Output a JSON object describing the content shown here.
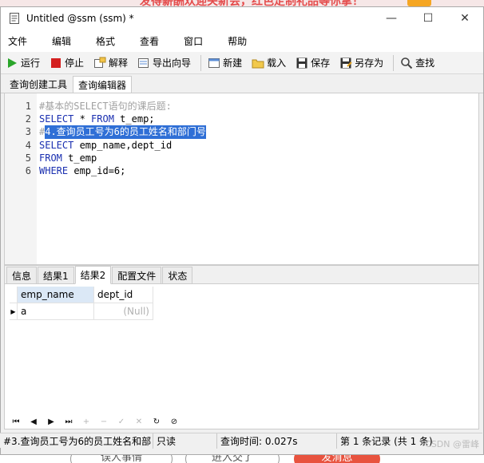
{
  "background": {
    "banner_text": "发得薪酬欢迎关新会，红色定制礼品等你拿！",
    "bottom_pills": [
      "误人事情",
      "进入交了",
      "发消息"
    ]
  },
  "window": {
    "title": "Untitled @ssm (ssm) *",
    "controls": {
      "minimize": "—",
      "maximize": "☐",
      "close": "✕"
    }
  },
  "menu": [
    "文件",
    "编辑",
    "格式",
    "查看",
    "窗口",
    "帮助"
  ],
  "toolbar": {
    "run": "运行",
    "stop": "停止",
    "explain": "解释",
    "export": "导出向导",
    "new": "新建",
    "load": "载入",
    "save": "保存",
    "save_as": "另存为",
    "find": "查找"
  },
  "tabs": [
    "查询创建工具",
    "查询编辑器"
  ],
  "editor": {
    "lines": [
      {
        "n": "1",
        "parts": [
          {
            "t": "#基本的SELECT语句的课后题:",
            "c": "cm"
          }
        ]
      },
      {
        "n": "2",
        "parts": [
          {
            "t": "SELECT",
            "c": "kw"
          },
          {
            "t": " * ",
            "c": ""
          },
          {
            "t": "FROM",
            "c": "kw"
          },
          {
            "t": " t_emp;",
            "c": ""
          }
        ]
      },
      {
        "n": "3",
        "parts": [
          {
            "t": "#",
            "c": "cm"
          },
          {
            "t": "4.查询员工号为6的员工姓名和部门号",
            "c": "sel"
          }
        ]
      },
      {
        "n": "4",
        "parts": [
          {
            "t": "SELECT",
            "c": "kw"
          },
          {
            "t": " emp_name,dept_id",
            "c": ""
          }
        ]
      },
      {
        "n": "5",
        "parts": [
          {
            "t": "FROM",
            "c": "kw"
          },
          {
            "t": " t_emp",
            "c": ""
          }
        ]
      },
      {
        "n": "6",
        "parts": [
          {
            "t": "WHERE",
            "c": "kw"
          },
          {
            "t": " emp_id=6;",
            "c": ""
          }
        ]
      }
    ]
  },
  "result_tabs": [
    "信息",
    "结果1",
    "结果2",
    "配置文件",
    "状态"
  ],
  "result_grid": {
    "columns": [
      "emp_name",
      "dept_id"
    ],
    "rows": [
      [
        "a",
        "(Null)"
      ]
    ]
  },
  "status": {
    "query": "#3.查询员工号为6的员工姓名和部",
    "mode": "只读",
    "time": "查询时间: 0.027s",
    "records": "第 1 条记录 (共 1 条)",
    "watermark": "CSDN @雷峰"
  }
}
